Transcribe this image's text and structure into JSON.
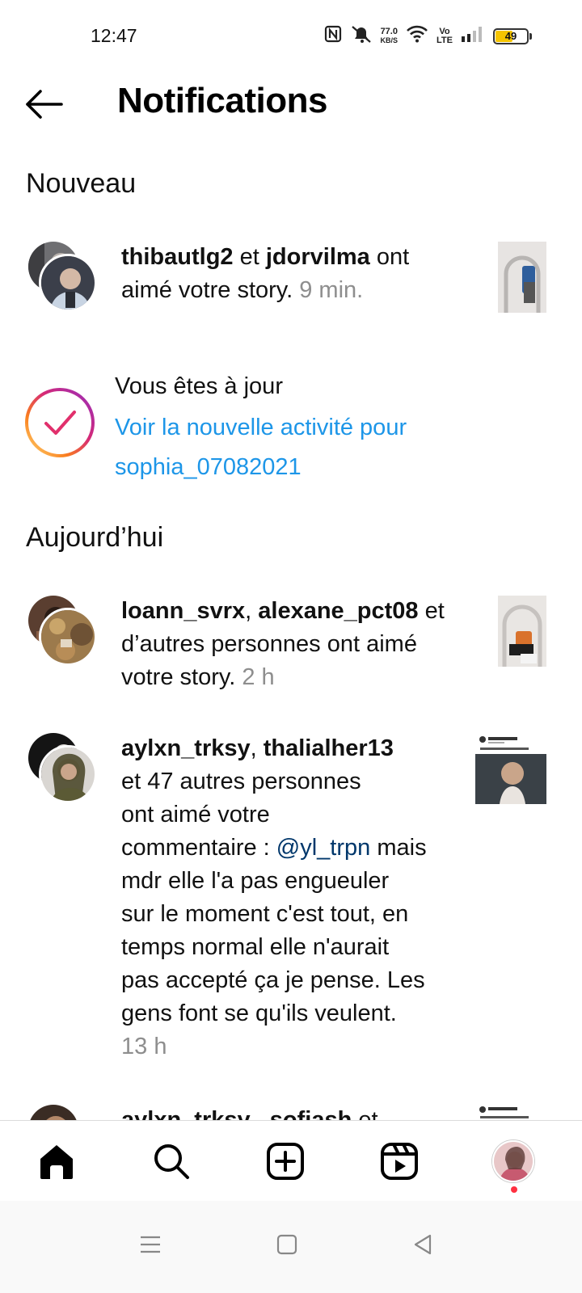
{
  "status_bar": {
    "time": "12:47",
    "net_speed_value": "77.0",
    "net_speed_unit": "KB/S",
    "volte": "Vo\nLTE",
    "battery_level": "49",
    "icons": [
      "nfc-icon",
      "mute-icon",
      "wifi-icon",
      "volte-icon",
      "signal-icon",
      "battery-icon"
    ]
  },
  "header": {
    "title": "Notifications"
  },
  "sections": {
    "new_title": "Nouveau",
    "today_title": "Aujourd’hui"
  },
  "notif_1": {
    "user_a": "thibautlg2",
    "conj": " et ",
    "user_b": "jdorvilma",
    "text": " ont aimé votre story. ",
    "time": "9 min."
  },
  "up_to_date": {
    "title": "Vous êtes à jour",
    "link": "Voir la nouvelle activité pour sophia_07082021"
  },
  "notif_2": {
    "user_a": "loann_svrx",
    "sep": ", ",
    "user_b": "alexane_pct08",
    "text": " et d’autres personnes ont aimé votre story. ",
    "time": "2 h"
  },
  "notif_3": {
    "user_a": "aylxn_trksy",
    "sep": ", ",
    "user_b": "thalialher13",
    "line_1": "et 47 autres personnes",
    "line_2": "ont aimé votre",
    "line_3": "commentaire : ",
    "mention": "@yl_trpn",
    "line_3_rest": " mais",
    "line_4": "mdr elle l'a pas engueuler",
    "line_5": "sur le moment c'est tout, en",
    "line_6": "temps normal elle n'aurait",
    "line_7": "pas accepté ça je pense. Les",
    "line_8": "gens font se qu'ils veulent.",
    "time": "13 h",
    "thumb_caption": "La meilleure vidéo de l'année"
  },
  "notif_4": {
    "user_a": "aylxn_trksy",
    "sep": " , ",
    "user_b": "sofiash",
    "text": " et"
  },
  "bottom_nav": {
    "items": [
      "home-icon",
      "search-icon",
      "create-icon",
      "reels-icon",
      "profile-avatar"
    ]
  },
  "colors": {
    "link_blue": "#1d96e8",
    "mention_blue": "#00376b",
    "time_gray": "#8e8e8e",
    "notification_dot": "#ff3040"
  }
}
